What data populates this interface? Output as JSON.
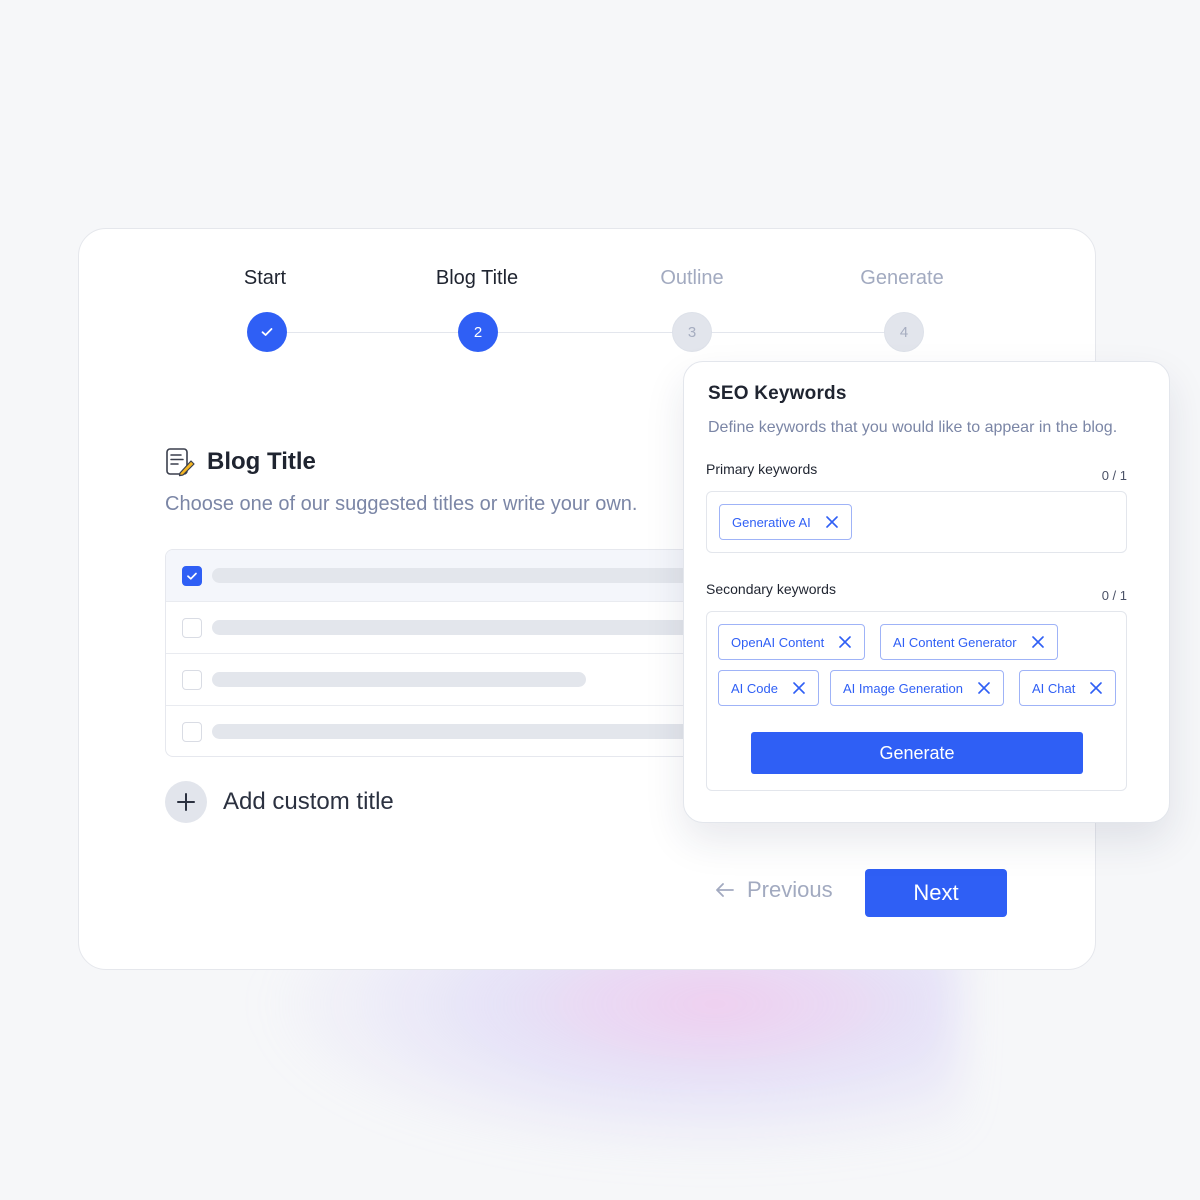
{
  "stepper": {
    "steps": [
      {
        "label": "Start",
        "state": "done",
        "marker": ""
      },
      {
        "label": "Blog Title",
        "state": "active",
        "marker": "2"
      },
      {
        "label": "Outline",
        "state": "pending",
        "marker": "3"
      },
      {
        "label": "Generate",
        "state": "pending",
        "marker": "4"
      }
    ]
  },
  "blog_title": {
    "icon": "edit-document-icon",
    "heading": "Blog Title",
    "subtitle": "Choose one of our suggested titles or write your own.",
    "suggestions": [
      {
        "checked": true
      },
      {
        "checked": false
      },
      {
        "checked": false
      },
      {
        "checked": false
      }
    ],
    "add_custom_label": "Add custom title"
  },
  "navigation": {
    "previous_label": "Previous",
    "next_label": "Next"
  },
  "seo": {
    "title": "SEO Keywords",
    "subtitle": "Define keywords that you would like to appear in the blog.",
    "primary": {
      "label": "Primary keywords",
      "count": "0 / 1",
      "chips": [
        "Generative AI"
      ]
    },
    "secondary": {
      "label": "Secondary keywords",
      "count": "0 / 1",
      "chips": [
        "OpenAI Content",
        "AI Content Generator",
        "AI Code",
        "AI Image Generation",
        "AI Chat"
      ]
    },
    "generate_label": "Generate"
  },
  "colors": {
    "accent": "#2f5ff5",
    "muted_text": "#7b86a6",
    "pending_step": "#e2e5ec"
  }
}
